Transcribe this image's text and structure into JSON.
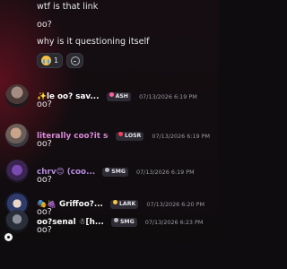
{
  "continued_lines": [
    "wtf is that link",
    "oo?",
    "why is it questioning itself"
  ],
  "reactions": {
    "cry_count": "1"
  },
  "messages": [
    {
      "username": "✨le oo? sav...",
      "tag": "ASH",
      "tag_color": "#ff5fa2",
      "timestamp": "07/13/2026 6:19 PM",
      "text": "oo?",
      "name_color": "#ffffff"
    },
    {
      "username": "literally coo?it se...",
      "tag": "LOSR",
      "tag_color": "#ff3b5c",
      "timestamp": "07/13/2026 6:19 PM",
      "text": "oo?",
      "name_color": "#d88ad8"
    },
    {
      "username": "chrv😊 (coo...",
      "tag": "SMG",
      "tag_color": "#b9bbc2",
      "timestamp": "07/13/2026 6:19 PM",
      "text": "oo?",
      "name_color": "#b58be0"
    },
    {
      "username": "🎭🍇 Griffoo?...",
      "tag": "LARK",
      "tag_color": "#f5c542",
      "timestamp": "07/13/2026 6:20 PM",
      "text": "oo?",
      "name_color": "#ffffff"
    },
    {
      "username": "oo?senal ☃[h...",
      "tag": "SMG",
      "tag_color": "#b9bbc2",
      "timestamp": "07/13/2026 6:23 PM",
      "text": "oo?",
      "name_color": "#ffffff"
    }
  ],
  "colors": {
    "background": "#0f0c10",
    "text": "#dbdee1",
    "timestamp": "#9a9ba3"
  }
}
